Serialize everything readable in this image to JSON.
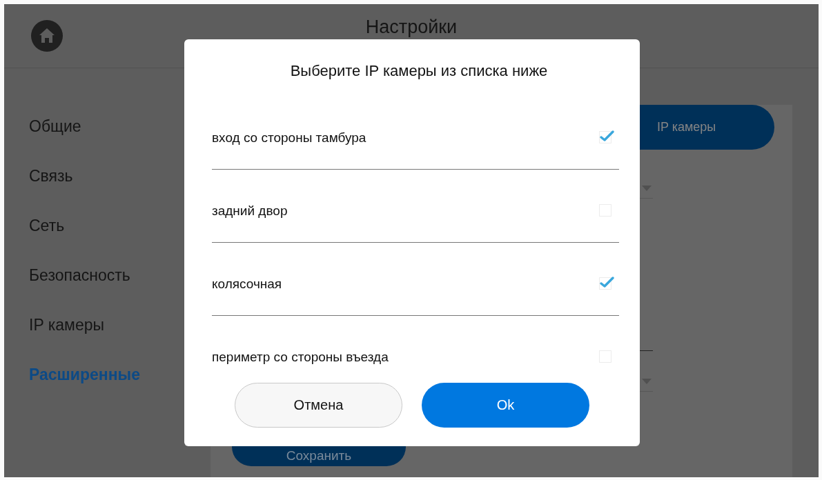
{
  "header": {
    "title": "Настройки"
  },
  "sidebar": {
    "items": [
      {
        "label": "Общие",
        "selected": false
      },
      {
        "label": "Связь",
        "selected": false
      },
      {
        "label": "Сеть",
        "selected": false
      },
      {
        "label": "Безопасность",
        "selected": false
      },
      {
        "label": "IP камеры",
        "selected": false
      },
      {
        "label": "Расширенные",
        "selected": true
      }
    ]
  },
  "panel": {
    "tab": {
      "label": "IP камеры"
    },
    "save_button": "Сохранить"
  },
  "dialog": {
    "title": "Выберите IP камеры из списка ниже",
    "items": [
      {
        "label": "вход со стороны тамбура",
        "checked": true
      },
      {
        "label": "задний двор",
        "checked": false
      },
      {
        "label": "колясочная",
        "checked": true
      },
      {
        "label": "периметр со стороны въезда",
        "checked": false
      }
    ],
    "buttons": [
      {
        "label": "Отмена",
        "kind": "secondary"
      },
      {
        "label": "Ok",
        "kind": "primary"
      }
    ]
  }
}
